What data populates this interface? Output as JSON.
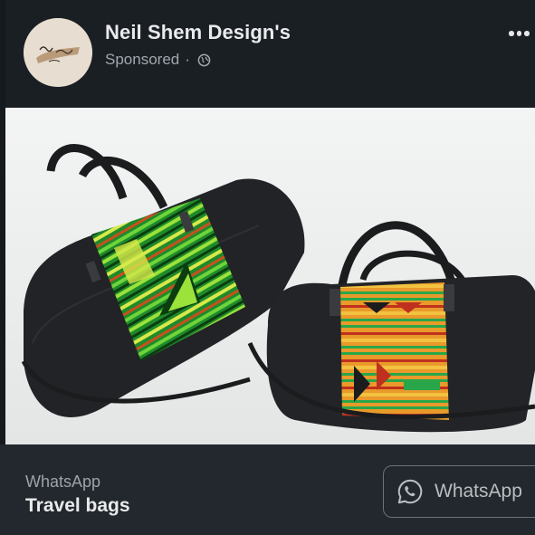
{
  "post": {
    "page_name": "Neil Shem Design's",
    "sponsored_label": "Sponsored",
    "separator": "·",
    "audience_icon": "globe-icon",
    "more_icon": "more-options-icon"
  },
  "ad": {
    "image_alt": "Two black travel duffel bags with kente cloth panels",
    "source": "WhatsApp",
    "title": "Travel bags",
    "cta_label": "WhatsApp",
    "cta_icon": "whatsapp-icon"
  },
  "colors": {
    "background": "#1a1f24",
    "footer": "#22282d",
    "text_primary": "#e9eaec",
    "text_secondary": "#a2a7ad"
  }
}
